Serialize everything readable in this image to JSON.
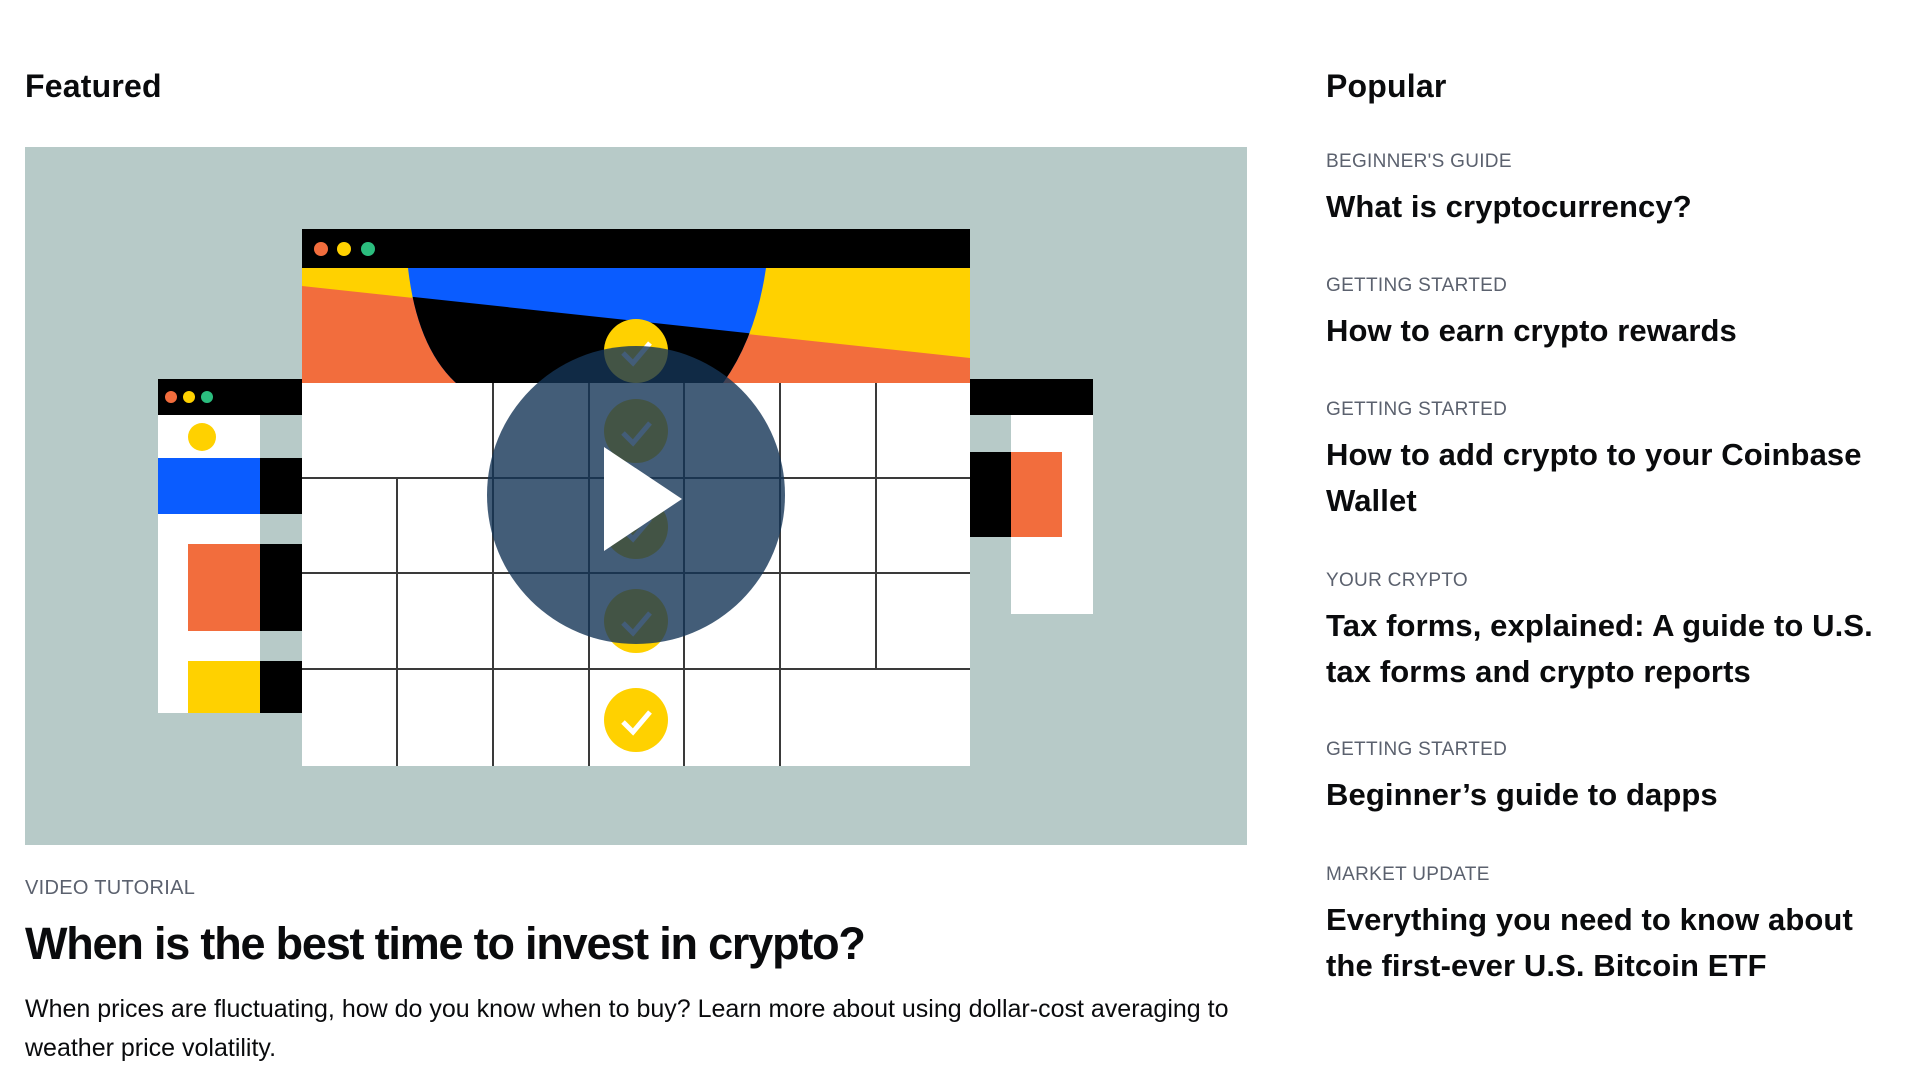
{
  "featured": {
    "section_title": "Featured",
    "media": {
      "type": "video",
      "play_icon": "play-icon",
      "illustration": "calendar-browser-windows",
      "colors": {
        "background": "#b7cac8",
        "orange": "#f26d3d",
        "yellow": "#ffd100",
        "blue": "#0a5cff",
        "green": "#2bbd7e",
        "black": "#000000",
        "play_overlay": "#163658"
      }
    },
    "eyebrow": "VIDEO TUTORIAL",
    "headline": "When is the best time to invest in crypto?",
    "description": "When prices are fluctuating, how do you know when to buy? Learn more about using dollar-cost averaging to weather price volatility."
  },
  "popular": {
    "section_title": "Popular",
    "items": [
      {
        "category": "BEGINNER'S GUIDE",
        "title": "What is cryptocurrency?"
      },
      {
        "category": "GETTING STARTED",
        "title": "How to earn crypto rewards"
      },
      {
        "category": "GETTING STARTED",
        "title": "How to add crypto to your Coinbase Wallet"
      },
      {
        "category": "YOUR CRYPTO",
        "title": "Tax forms, explained: A guide to U.S. tax forms and crypto reports"
      },
      {
        "category": "GETTING STARTED",
        "title": "Beginner’s guide to dapps"
      },
      {
        "category": "MARKET UPDATE",
        "title": "Everything you need to know about the first-ever U.S. Bitcoin ETF"
      }
    ]
  }
}
